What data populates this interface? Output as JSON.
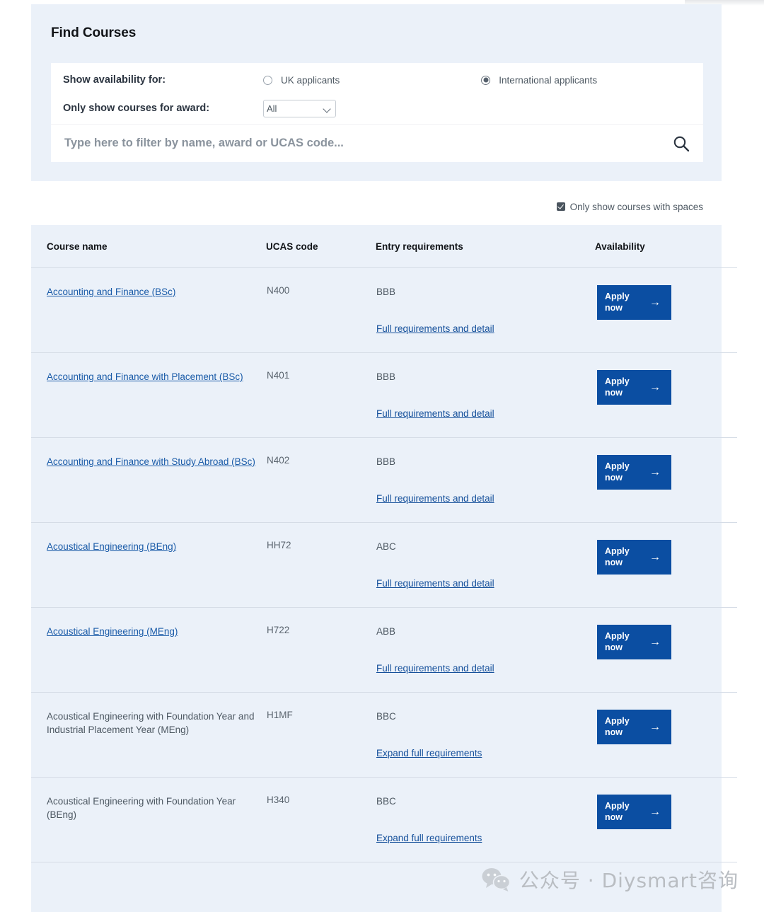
{
  "find_panel": {
    "title": "Find Courses",
    "availability_label": "Show availability for:",
    "award_label": "Only show courses for award:",
    "radio_uk": "UK applicants",
    "radio_intl": "International applicants",
    "selected_radio": "International applicants",
    "award_selected": "All",
    "award_options": [
      "All"
    ],
    "search_placeholder": "Type here to filter by name, award or UCAS code...",
    "search_value": "",
    "search_icon": "search-icon"
  },
  "filters": {
    "spaces_label": "Only show courses with spaces",
    "spaces_checked": true
  },
  "table": {
    "headers": [
      "Course name",
      "UCAS code",
      "Entry requirements",
      "Availability"
    ],
    "apply_label_line1": "Apply",
    "apply_label_line2": "now",
    "apply_arrow": "→",
    "rows": [
      {
        "name": "Accounting and Finance (BSc)",
        "is_link": true,
        "ucas": "N400",
        "grades": "BBB",
        "req_link": "Full requirements and detail"
      },
      {
        "name": "Accounting and Finance with Placement (BSc)",
        "is_link": true,
        "ucas": "N401",
        "grades": "BBB",
        "req_link": "Full requirements and detail"
      },
      {
        "name": "Accounting and Finance with Study Abroad (BSc)",
        "is_link": true,
        "ucas": "N402",
        "grades": "BBB",
        "req_link": "Full requirements and detail"
      },
      {
        "name": "Acoustical Engineering (BEng)",
        "is_link": true,
        "ucas": "HH72",
        "grades": "ABC",
        "req_link": "Full requirements and detail"
      },
      {
        "name": "Acoustical Engineering (MEng)",
        "is_link": true,
        "ucas": "H722",
        "grades": "ABB",
        "req_link": "Full requirements and detail"
      },
      {
        "name": "Acoustical Engineering with Foundation Year and Industrial Placement Year (MEng)",
        "is_link": false,
        "ucas": "H1MF",
        "grades": "BBC",
        "req_link": "Expand full requirements"
      },
      {
        "name": "Acoustical Engineering with Foundation Year (BEng)",
        "is_link": false,
        "ucas": "H340",
        "grades": "BBC",
        "req_link": "Expand full requirements"
      }
    ]
  },
  "watermark": {
    "text": "公众号 · Diysmart咨询",
    "icon": "wechat-icon"
  },
  "colors": {
    "panel_bg": "#ebf1f9",
    "accent_blue": "#0b4ea2",
    "link_blue": "#15509b",
    "text": "#4d5862"
  }
}
